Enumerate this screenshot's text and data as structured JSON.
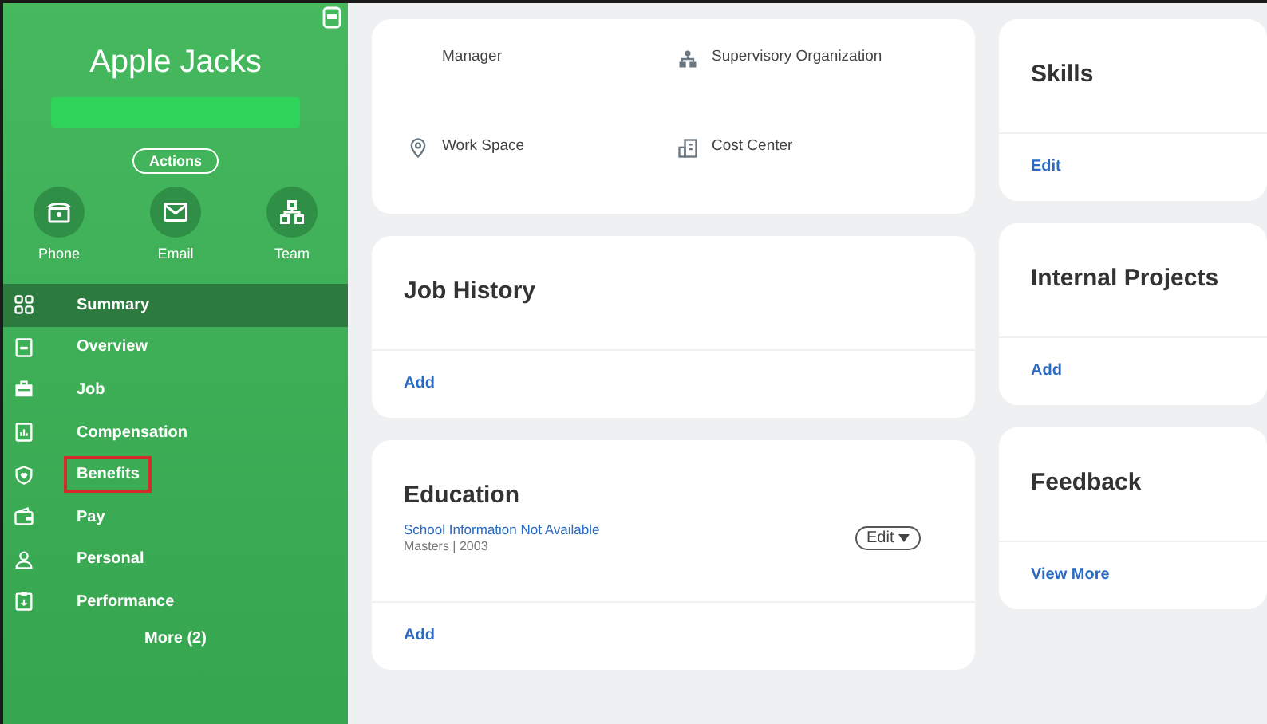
{
  "profile": {
    "name": "Apple Jacks",
    "redacted_subtitle": true,
    "actions_label": "Actions",
    "quick_actions": [
      {
        "label": "Phone",
        "kind": "phone"
      },
      {
        "label": "Email",
        "kind": "email"
      },
      {
        "label": "Team",
        "kind": "team"
      }
    ]
  },
  "nav": {
    "items": [
      {
        "label": "Summary",
        "kind": "grid",
        "selected": true,
        "highlighted": false
      },
      {
        "label": "Overview",
        "kind": "doc",
        "selected": false,
        "highlighted": false
      },
      {
        "label": "Job",
        "kind": "briefcase",
        "selected": false,
        "highlighted": false
      },
      {
        "label": "Compensation",
        "kind": "chart",
        "selected": false,
        "highlighted": false
      },
      {
        "label": "Benefits",
        "kind": "shield",
        "selected": false,
        "highlighted": true
      },
      {
        "label": "Pay",
        "kind": "wallet",
        "selected": false,
        "highlighted": false
      },
      {
        "label": "Personal",
        "kind": "person",
        "selected": false,
        "highlighted": false
      },
      {
        "label": "Performance",
        "kind": "clipboard",
        "selected": false,
        "highlighted": false
      }
    ],
    "more": "More (2)"
  },
  "middle_column": [
    {
      "kind": "fields",
      "fields": [
        {
          "label": "Manager"
        },
        {
          "label": "Supervisory Organization",
          "kind": "org"
        },
        {
          "label": "Work Space",
          "kind": "pin"
        },
        {
          "label": "Cost Center",
          "kind": "building"
        }
      ]
    },
    {
      "kind": "list",
      "title": "Job History",
      "footer_link": "Add"
    },
    {
      "kind": "list",
      "title": "Education",
      "entries": [
        {
          "title": "School Information Not Available",
          "detail": "Masters | 2003",
          "edit_label": "Edit"
        }
      ],
      "footer_link": "Add"
    }
  ],
  "right_column": [
    {
      "kind": "list",
      "title": "Skills",
      "footer_link": "Edit"
    },
    {
      "kind": "list",
      "title": "Internal Projects",
      "footer_link": "Add"
    },
    {
      "kind": "list",
      "title": "Feedback",
      "footer_link": "View More"
    }
  ]
}
